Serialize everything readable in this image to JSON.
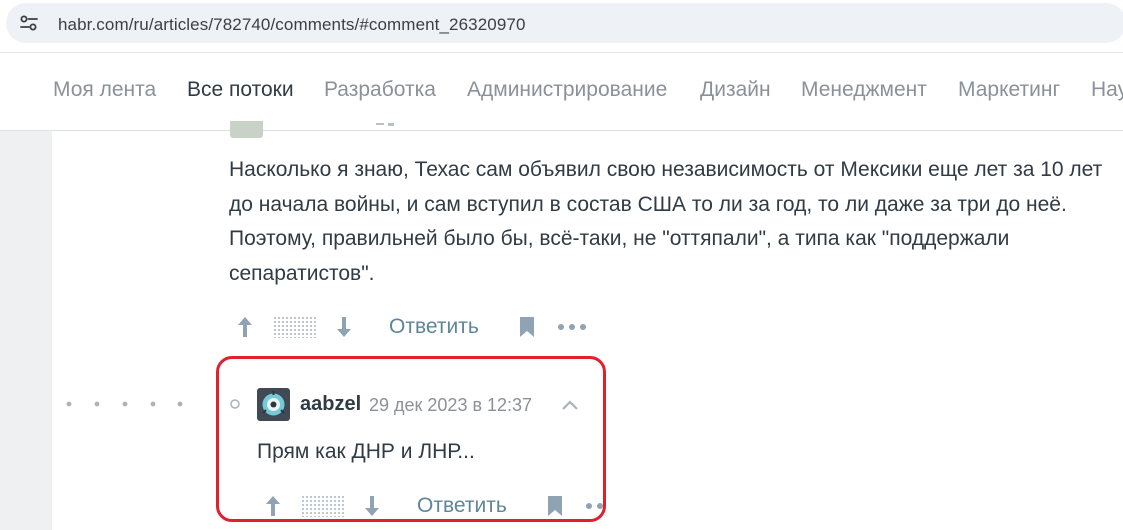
{
  "browser": {
    "url": "habr.com/ru/articles/782740/comments/#comment_26320970"
  },
  "nav": {
    "items": [
      {
        "label": "Моя лента",
        "active": false
      },
      {
        "label": "Все потоки",
        "active": true
      },
      {
        "label": "Разработка",
        "active": false
      },
      {
        "label": "Администрирование",
        "active": false
      },
      {
        "label": "Дизайн",
        "active": false
      },
      {
        "label": "Менеджмент",
        "active": false
      },
      {
        "label": "Маркетинг",
        "active": false
      },
      {
        "label": "Нау",
        "active": false
      }
    ]
  },
  "comment": {
    "text": "Насколько я знаю, Техас сам объявил свою независимость от Мексики еще лет за 10 лет до начала войны, и сам вступил в состав США то ли за год, то ли даже за три до неё. Поэтому, правильней было бы, всё-таки, не \"оттяпали\", а типа как \"поддержали сепаратистов\".",
    "reply_label": "Ответить"
  },
  "reply": {
    "username": "aabzel",
    "date": "29 дек 2023 в 12:37",
    "text": "Прям как ДНР и ЛНР...",
    "reply_label": "Ответить"
  },
  "colors": {
    "accent_link": "#5e8699",
    "text": "#303b44",
    "muted": "#8a9199",
    "highlight_border": "#e0202c"
  }
}
